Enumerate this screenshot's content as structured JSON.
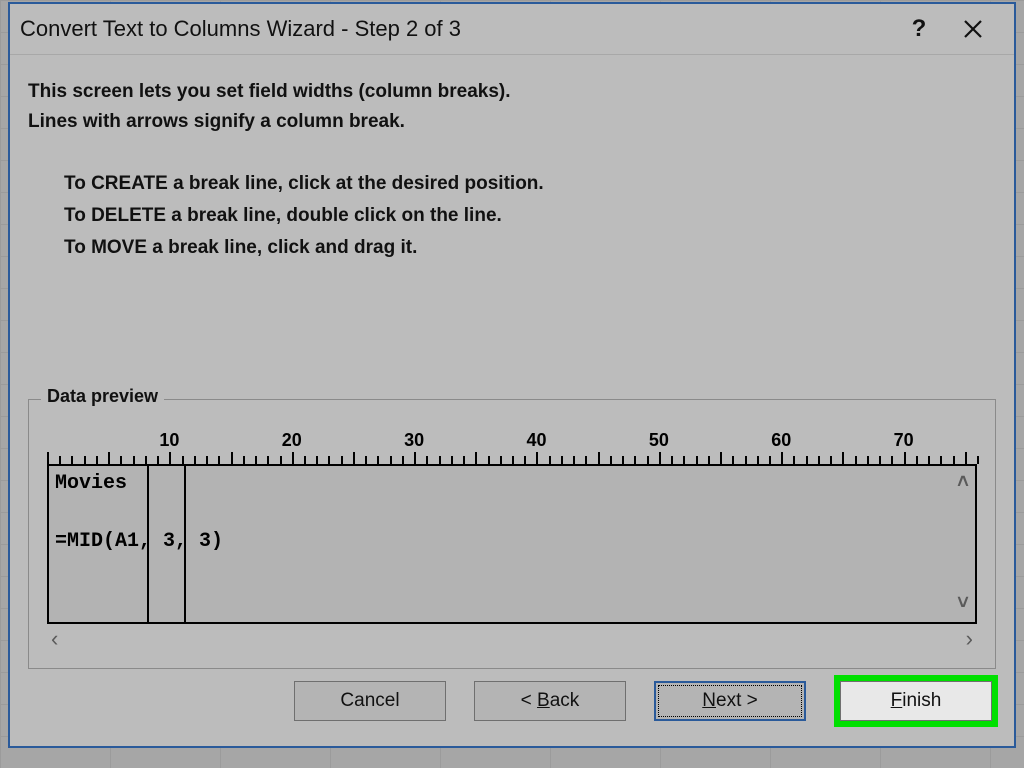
{
  "dialog": {
    "title": "Convert Text to Columns Wizard - Step 2 of 3",
    "help_symbol": "?",
    "intro_line1": "This screen lets you set field widths (column breaks).",
    "intro_line2": "Lines with arrows signify a column break.",
    "instr_create": "To CREATE a break line, click at the desired position.",
    "instr_delete": "To DELETE a break line, double click on the line.",
    "instr_move": "To MOVE a break line, click and drag it."
  },
  "preview": {
    "legend": "Data preview",
    "ruler_labels": [
      "10",
      "20",
      "30",
      "40",
      "50",
      "60",
      "70"
    ],
    "break_positions_chars": [
      8,
      11
    ],
    "rows": [
      "Movies",
      "=MID(A1, 3, 3)"
    ]
  },
  "buttons": {
    "cancel": "Cancel",
    "back_lt": "< ",
    "back_ul": "B",
    "back_rest": "ack",
    "next_ul": "N",
    "next_rest": "ext >",
    "finish_ul": "F",
    "finish_rest": "inish"
  }
}
